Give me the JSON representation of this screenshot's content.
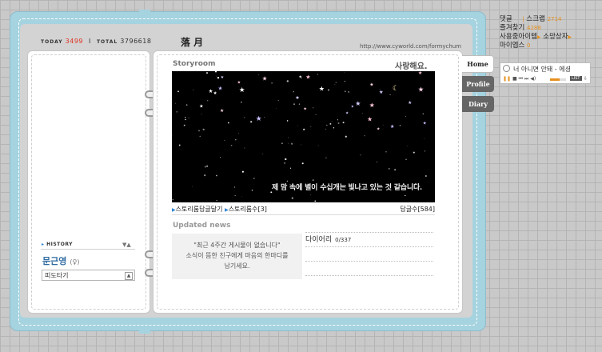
{
  "header": {
    "today_label": "TODAY",
    "today_count": "3499",
    "divider": "I",
    "total_label": "TOTAL",
    "total_count": "3796618",
    "title": "落 月",
    "url": "http://www.cyworld.com/formychum"
  },
  "profile": {
    "history_label": "HISTORY",
    "history_toggle": "▼▲",
    "name": "문근영",
    "gender": "(♀)",
    "mood": "피도타기",
    "mood_arrow": "▲"
  },
  "storyroom": {
    "label": "Storyroom",
    "caption": "사랑해요.",
    "image_text": "제 맘 속에 별이 수십개는 빛나고 있는 것 같습니다.",
    "link1": "스토리룸답글달기",
    "link2": "스토리룸수",
    "link2_count": "[3]",
    "reply_label": "답글수",
    "reply_count": "[584]"
  },
  "updated": {
    "label": "Updated news",
    "line1": "\"최근 4주간 게시물이 없습니다\"",
    "line2": "소식이 뜸한 친구에게 마음의 한마디를",
    "line3": "남기세요.",
    "diary_label": "다이어리",
    "diary_count": "0/337"
  },
  "tabs": {
    "home": "Home",
    "profile": "Profile",
    "diary": "Diary"
  },
  "widget": {
    "comment": "댓글",
    "scrap": "스크랩",
    "scrap_count": "2714",
    "favorites": "즐겨찾기",
    "favorites_count": "4288",
    "items": "사용중아이템",
    "gift": "소망상자",
    "minimeps": "마이엡스",
    "minimeps_count": "0",
    "song": "너 아니면 안돼 - 에셩",
    "list": "LIST"
  },
  "colors": {
    "frame": "#a5d3df",
    "today_red": "#e0311f",
    "name_blue": "#2d6aa0",
    "accent_orange": "#e7901f"
  }
}
